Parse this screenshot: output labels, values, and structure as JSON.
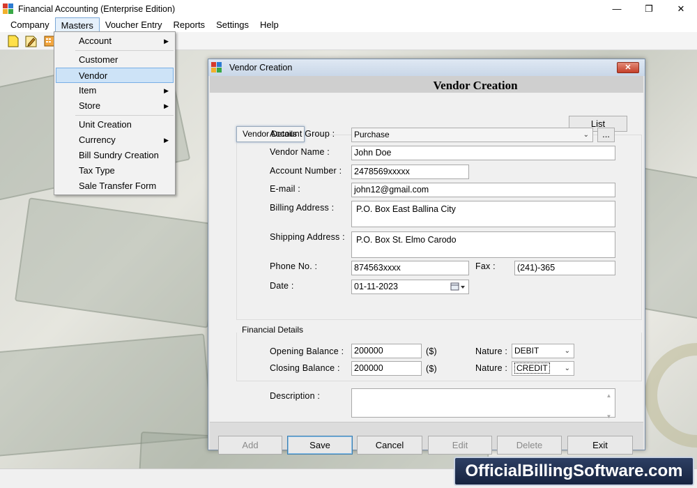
{
  "window": {
    "title": "Financial Accounting (Enterprise Edition)",
    "minimize": "—",
    "restore": "❐",
    "close": "✕"
  },
  "menubar": {
    "items": [
      "Company",
      "Masters",
      "Voucher Entry",
      "Reports",
      "Settings",
      "Help"
    ]
  },
  "masters_menu": {
    "items": [
      {
        "label": "Account",
        "submenu": true
      },
      {
        "label": "Customer",
        "submenu": false
      },
      {
        "label": "Vendor",
        "submenu": false,
        "selected": true
      },
      {
        "label": "Item",
        "submenu": true
      },
      {
        "label": "Store",
        "submenu": true
      },
      {
        "label": "Unit Creation",
        "submenu": false
      },
      {
        "label": "Currency",
        "submenu": true
      },
      {
        "label": "Bill Sundry Creation",
        "submenu": false
      },
      {
        "label": "Tax Type",
        "submenu": false
      },
      {
        "label": "Sale Transfer Form",
        "submenu": false
      }
    ],
    "submenu_arrow": "▶"
  },
  "dialog": {
    "title": "Vendor Creation",
    "close": "✕",
    "heading": "Vendor Creation",
    "list_button": "List",
    "vendor_details_tab": "Vendor Details",
    "account_group": {
      "label": "Account Group :",
      "value": "Purchase",
      "browse": "..."
    },
    "vendor_name": {
      "label": "Vendor Name :",
      "value": "John Doe"
    },
    "account_number": {
      "label": "Account Number :",
      "value": "2478569xxxxx"
    },
    "email": {
      "label": "E-mail :",
      "value": "john12@gmail.com"
    },
    "billing_address": {
      "label": "Billing Address :",
      "value": "P.O. Box East Ballina City"
    },
    "shipping_address": {
      "label": "Shipping Address :",
      "value": "P.O. Box St. Elmo Carodo"
    },
    "phone": {
      "label": "Phone No. :",
      "value": "874563xxxx"
    },
    "fax": {
      "label": "Fax :",
      "value": "(241)-365"
    },
    "date": {
      "label": "Date :",
      "value": "01-11-2023"
    },
    "financial_details": "Financial Details",
    "opening_balance": {
      "label": "Opening Balance :",
      "value": "200000",
      "unit": "($)",
      "nature_label": "Nature :",
      "nature": "DEBIT"
    },
    "closing_balance": {
      "label": "Closing Balance :",
      "value": "200000",
      "unit": "($)",
      "nature_label": "Nature :",
      "nature": "CREDIT"
    },
    "description": {
      "label": "Description :",
      "value": ""
    },
    "buttons": {
      "add": "Add",
      "save": "Save",
      "cancel": "Cancel",
      "edit": "Edit",
      "delete": "Delete",
      "exit": "Exit"
    }
  },
  "watermark": "OfficialBillingSoftware.com",
  "colors": {
    "menu_selected": "#cde3f7",
    "close_button": "#c43f2a",
    "watermark_bg": "#16233f"
  }
}
